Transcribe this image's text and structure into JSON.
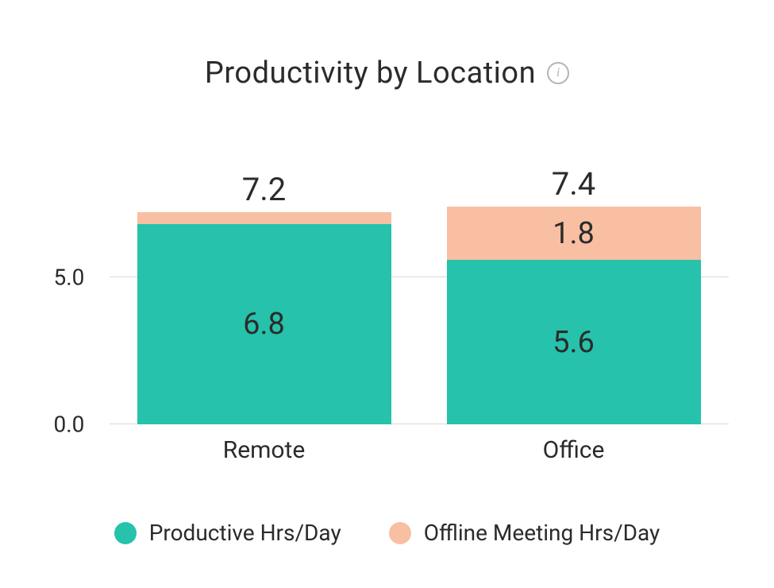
{
  "title": "Productivity by Location",
  "info_icon": "i",
  "chart_data": {
    "type": "bar",
    "stacked": true,
    "categories": [
      "Remote",
      "Office"
    ],
    "series": [
      {
        "name": "Productive Hrs/Day",
        "values": [
          6.8,
          5.6
        ],
        "color": "#26c2ab"
      },
      {
        "name": "Offline Meeting Hrs/Day",
        "values": [
          0.4,
          1.8
        ],
        "color": "#f8bfa3"
      }
    ],
    "totals": [
      7.2,
      7.4
    ],
    "ylim": [
      0,
      10
    ],
    "yticks": [
      0.0,
      5.0
    ],
    "xlabel": "",
    "ylabel": ""
  },
  "axis": {
    "tick0": "0.0",
    "tick5": "5.0"
  },
  "bars": {
    "remote": {
      "total": "7.2",
      "productive": "6.8",
      "meeting": ""
    },
    "office": {
      "total": "7.4",
      "productive": "5.6",
      "meeting": "1.8"
    }
  },
  "categories": {
    "cat0": "Remote",
    "cat1": "Office"
  },
  "legend": {
    "item0": "Productive Hrs/Day",
    "item1": "Offline Meeting Hrs/Day"
  },
  "colors": {
    "teal": "#26c2ab",
    "salmon": "#f8bfa3"
  }
}
